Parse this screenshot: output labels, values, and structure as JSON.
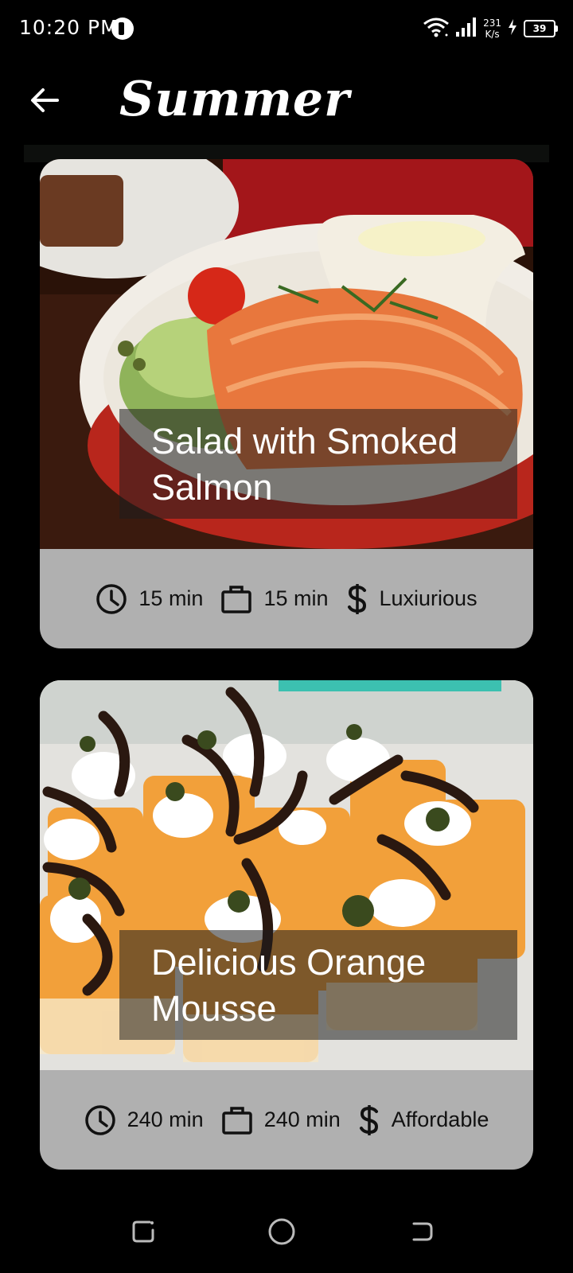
{
  "status_bar": {
    "time": "10:20 PM",
    "netspeed_value": "231",
    "netspeed_unit": "K/s",
    "battery": "39"
  },
  "app_bar": {
    "back_icon": "arrow-left-icon",
    "title": "Summer"
  },
  "meals": [
    {
      "title": "Salad with Smoked Salmon",
      "duration": "15 min",
      "complexity": "15 min",
      "affordability": "Luxiurious",
      "icons": [
        "clock-icon",
        "briefcase-icon",
        "dollar-icon"
      ]
    },
    {
      "title": "Delicious Orange Mousse",
      "duration": "240 min",
      "complexity": "240 min",
      "affordability": "Affordable",
      "icons": [
        "clock-icon",
        "briefcase-icon",
        "dollar-icon"
      ]
    }
  ],
  "colors": {
    "background": "#000000",
    "card_footer": "#b0b0b0",
    "title_overlay": "#1e1e1e"
  }
}
